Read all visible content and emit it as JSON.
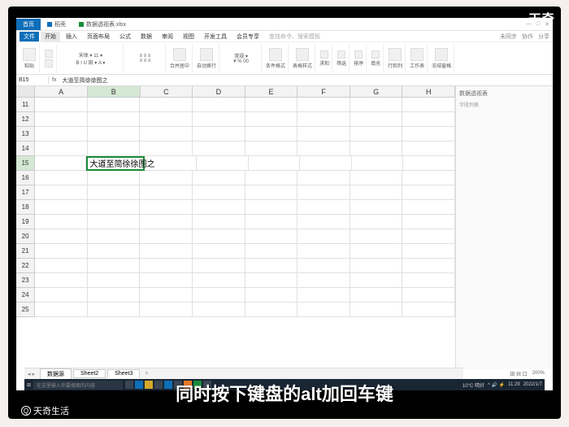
{
  "brand_topright": "天奇",
  "subtitle_text": "同时按下键盘的alt加回车键",
  "watermark": "天奇生活",
  "titlebar": {
    "home_tab": "首页",
    "doc_tab": "稻壳",
    "file_tab": "数据透视表.xlsx"
  },
  "menu": {
    "file": "文件",
    "items": [
      "开始",
      "插入",
      "页面布局",
      "公式",
      "数据",
      "审阅",
      "视图",
      "开发工具",
      "会员专享"
    ],
    "search_hint": "查找命令、搜索模板",
    "right": [
      "未同步",
      "协作",
      "分享"
    ]
  },
  "namebox": {
    "ref": "B15",
    "fx": "fx",
    "formula": "大道至简徐徐图之"
  },
  "columns": [
    "A",
    "B",
    "C",
    "D",
    "E",
    "F",
    "G",
    "H"
  ],
  "rows": [
    11,
    12,
    13,
    14,
    15,
    16,
    17,
    18,
    19,
    20,
    21,
    22,
    23,
    24,
    25
  ],
  "active_cell": {
    "row": 15,
    "col": "B",
    "text": "大道至简徐徐图之"
  },
  "sidepanel": {
    "title": "数据透视表",
    "subtitle": "字段列表"
  },
  "sheet_tabs": [
    "数据源",
    "Sheet2",
    "Sheet3"
  ],
  "statusbar": {
    "zoom": "200%"
  },
  "taskbar": {
    "search_placeholder": "在这里输入你要搜索的内容",
    "weather": "10°C 晴好",
    "time": "11:29",
    "date": "2022/1/7"
  }
}
